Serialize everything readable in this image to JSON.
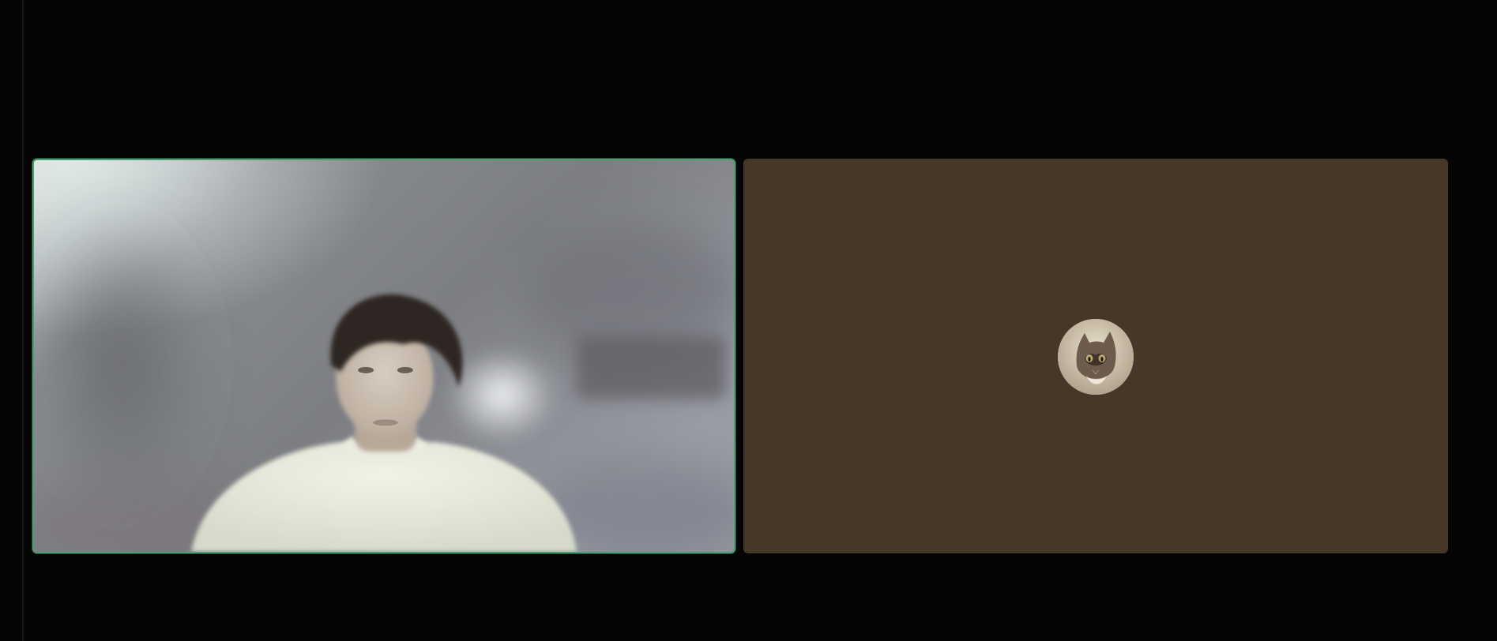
{
  "meeting": {
    "layout": "gallery",
    "active_speaker_border_color": "#4f9e72",
    "participants": [
      {
        "tile": "video",
        "camera": "on",
        "active_speaker": true
      },
      {
        "tile": "avatar",
        "camera": "off",
        "avatar_icon": "cat-photo-avatar",
        "tile_color": "#453829"
      }
    ]
  }
}
